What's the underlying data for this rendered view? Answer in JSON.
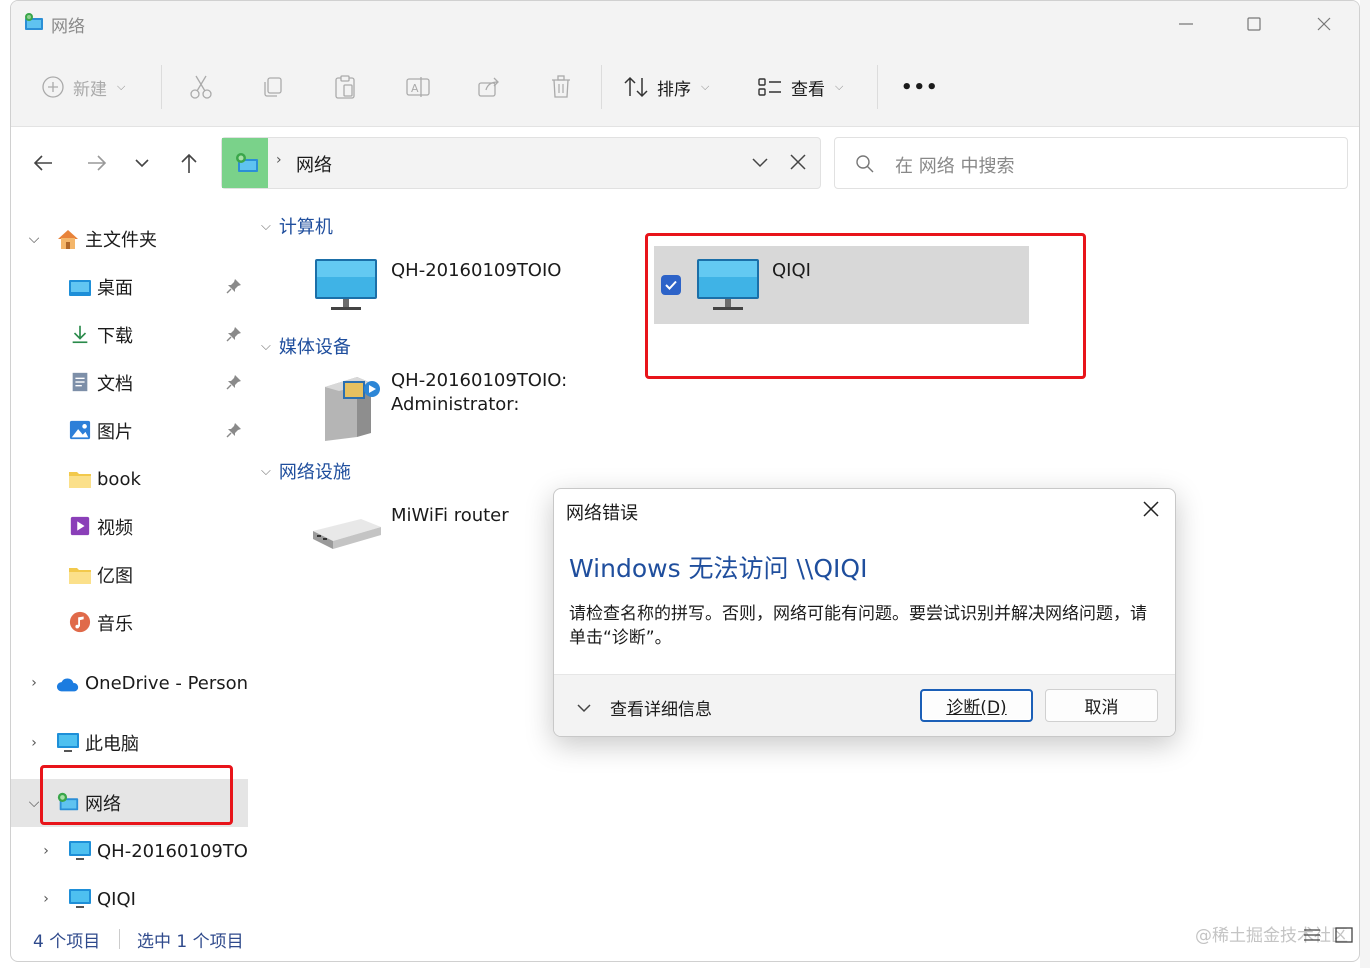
{
  "window": {
    "title": "网络"
  },
  "toolbar": {
    "new_label": "新建",
    "sort_label": "排序",
    "view_label": "查看",
    "more_label": "•••"
  },
  "address": {
    "crumb": "网络"
  },
  "search": {
    "placeholder": "在 网络 中搜索"
  },
  "sidebar": {
    "home": "主文件夹",
    "quick": [
      {
        "label": "桌面"
      },
      {
        "label": "下载"
      },
      {
        "label": "文档"
      },
      {
        "label": "图片"
      },
      {
        "label": "book"
      },
      {
        "label": "视频"
      },
      {
        "label": "亿图"
      },
      {
        "label": "音乐"
      }
    ],
    "onedrive": "OneDrive - Persona",
    "thispc": "此电脑",
    "network": "网络",
    "net_children": [
      {
        "label": "QH-20160109TO"
      },
      {
        "label": "QIQI"
      }
    ]
  },
  "status": {
    "count": "4 个项目",
    "selected": "选中 1 个项目"
  },
  "content": {
    "groups": {
      "computer": "计算机",
      "media": "媒体设备",
      "infra": "网络设施"
    },
    "computers": [
      {
        "name": "QH-20160109TOIO"
      },
      {
        "name": "QIQI"
      }
    ],
    "media": {
      "line1": "QH-20160109TOIO:",
      "line2": "Administrator:"
    },
    "infra": {
      "name": "MiWiFi router"
    }
  },
  "dialog": {
    "title": "网络错误",
    "heading": "Windows 无法访问 \\\\QIQI",
    "message": "请检查名称的拼写。否则，网络可能有问题。要尝试识别并解决网络问题，请单击“诊断”。",
    "details_label": "查看详细信息",
    "diagnose_label": "诊断(D)",
    "cancel_label": "取消"
  },
  "watermark": "@稀土掘金技术社区",
  "colors": {
    "accent": "#1f4e9d",
    "highlight_box": "#e8141a",
    "address_highlight": "#7ad28a",
    "checkbox": "#2d63c8"
  }
}
